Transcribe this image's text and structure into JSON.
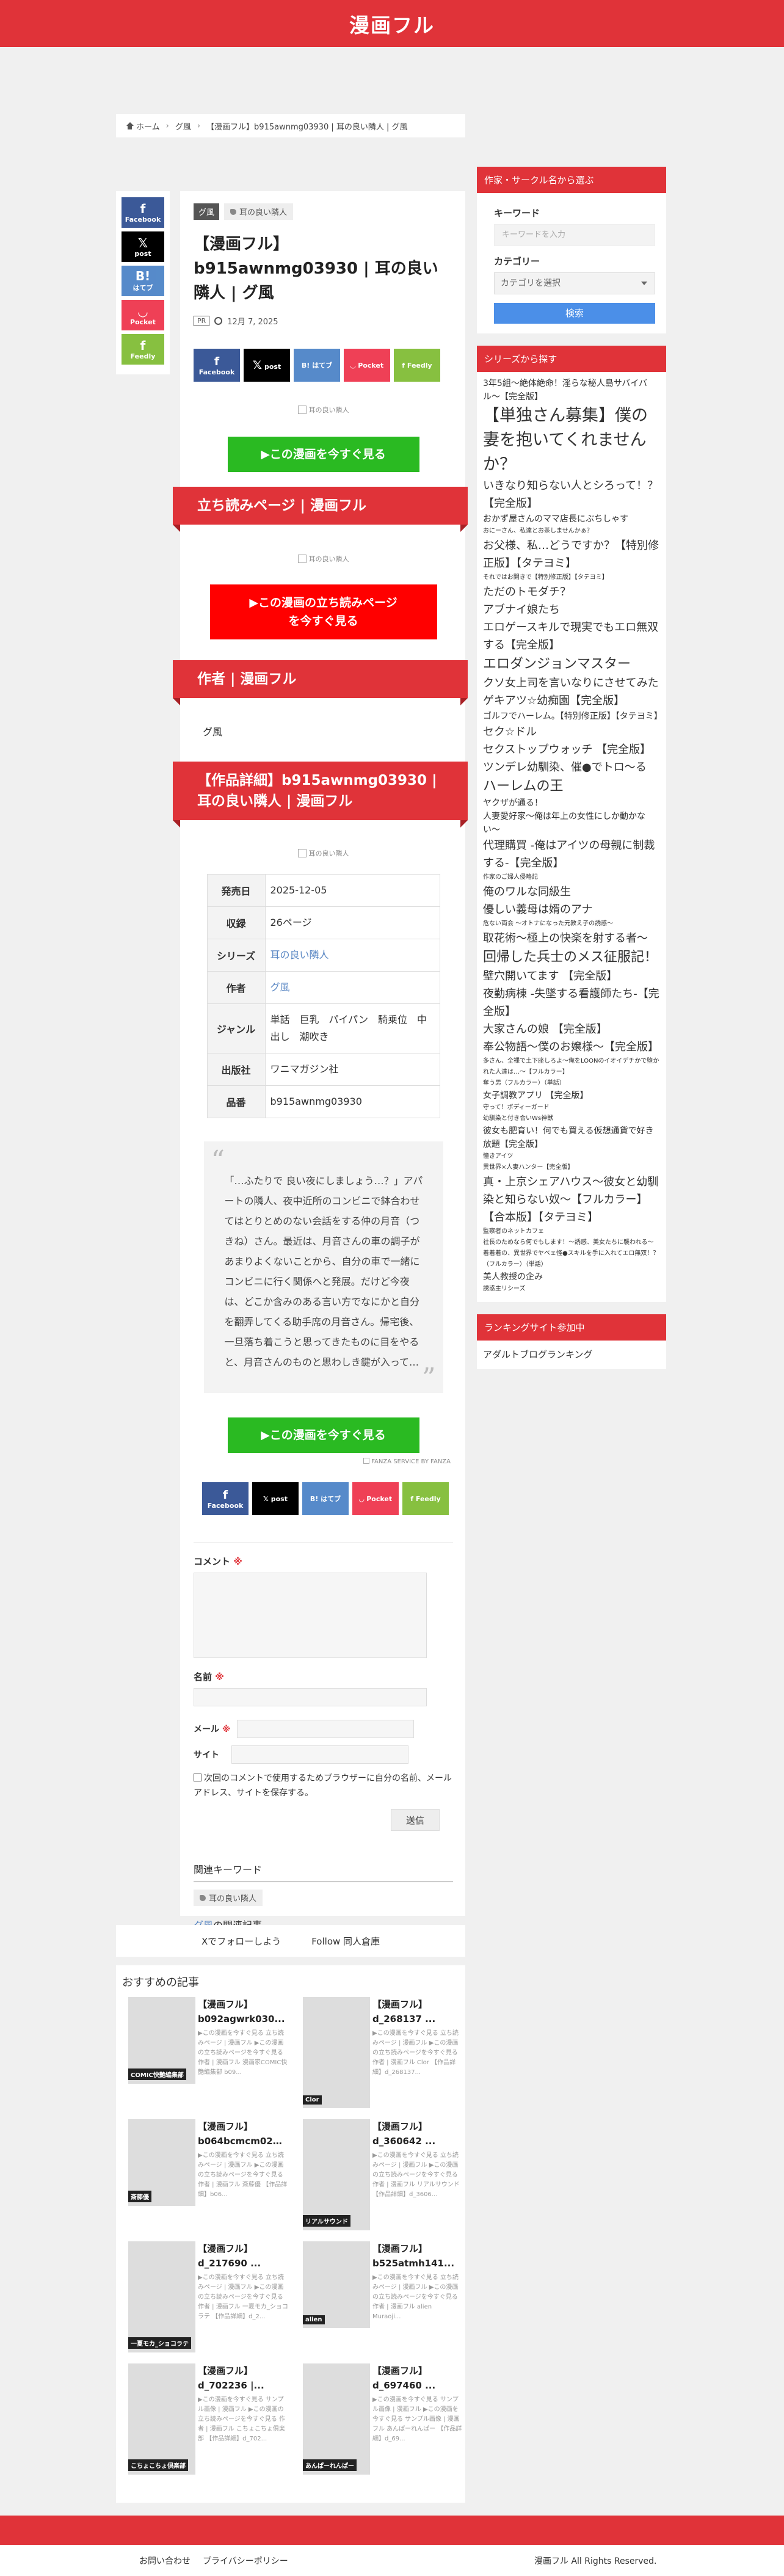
{
  "site": {
    "title": "漫画フル"
  },
  "breadcrumb": {
    "home": "ホーム",
    "category": "グ風",
    "current": "【漫画フル】b915awnmg03930 | 耳の良い隣人 | グ風"
  },
  "share": {
    "facebook": "Facebook",
    "x": "post",
    "hatena": "はてブ",
    "pocket": "Pocket",
    "feedly": "Feedly",
    "x_symbol": "𝕏",
    "hatena_symbol": "B!",
    "feedly_symbol": "f"
  },
  "article": {
    "category": "グ風",
    "tag": "耳の良い隣人",
    "title": "【漫画フル】b915awnmg03930 | 耳の良い隣人 | グ風",
    "pr": "PR",
    "date": "12月 7, 2025",
    "image_alt": "耳の良い隣人",
    "cta_read": "▶この漫画を今すぐ見る",
    "preview_heading": "立ち読みページ | 漫画フル",
    "cta_preview_line1": "▶この漫画の立ち読みページ",
    "cta_preview_line2": "を今すぐ見る",
    "author_heading": "作者 | 漫画フル",
    "author_name": "グ風",
    "detail_heading": "【作品詳細】b915awnmg03930 | 耳の良い隣人 | 漫画フル",
    "details": [
      {
        "label": "発売日",
        "value": "2025-12-05"
      },
      {
        "label": "収録",
        "value": "26ページ"
      },
      {
        "label": "シリーズ",
        "value": "耳の良い隣人"
      },
      {
        "label": "作者",
        "value": "グ風"
      },
      {
        "label": "ジャンル",
        "value": "単話　巨乳　パイパン　騎乗位　中出し　潮吹き"
      },
      {
        "label": "出版社",
        "value": "ワニマガジン社"
      },
      {
        "label": "品番",
        "value": "b915awnmg03930"
      }
    ],
    "quote": "「…ふたりで 良い夜にしましょう…？」アパートの隣人、夜中近所のコンビニで鉢合わせてはとりとめのない会話をする仲の月音（つきね）さん。最近は、月音さんの車の調子があまりよくないことから、自分の車で一緒にコンビニに行く関係へと発展。だけど今夜は、どこか含みのある言い方でなにかと自分を翻弄してくる助手席の月音さん。帰宅後、一旦落ち着こうと思ってきたものに目をやると、月音さんのものと思わしき鍵が入って…",
    "affiliate": "FANZA SERVICE BY FANZA"
  },
  "comment": {
    "label": "コメント",
    "req": "※",
    "name_label": "名前",
    "email_label": "メール",
    "site_label": "サイト",
    "save_info": "次回のコメントで使用するためブラウザーに自分の名前、メールアドレス、サイトを保存する。",
    "submit": "送信"
  },
  "related": {
    "keywords_heading": "関連キーワード",
    "keyword": "耳の良い隣人",
    "comics_author": "グ風",
    "comics_suffix": "の関連記事"
  },
  "follow": {
    "x": "Xでフォローしよう",
    "doujin": "Follow 同人倉庫"
  },
  "recommended": {
    "title": "おすすめの記事",
    "items": [
      {
        "t1": "【漫画フル】",
        "t2": "b092agwrk030...",
        "snippet": "▶この漫画を今すぐ見る 立ち読みページ | 漫画フル ▶この漫画の立ち読みページを今すぐ見る 作者 | 漫画フル 漫画家COMIC快艶編集部 b09...",
        "label": "COMIC快艶編集部"
      },
      {
        "t1": "【漫画フル】",
        "t2": "d_268137 ...",
        "snippet": "▶この漫画を今すぐ見る 立ち読みページ | 漫画フル ▶この漫画の立ち読みページを今すぐ見る 作者 | 漫画フル Clor 【作品詳細】d_268137...",
        "label": "Clor"
      },
      {
        "t1": "【漫画フル】",
        "t2": "b064bcmcm026...",
        "snippet": "▶この漫画を今すぐ見る 立ち読みページ | 漫画フル ▶この漫画の立ち読みページを今すぐ見る 作者 | 漫画フル 斎藤優 【作品詳細】b06...",
        "label": "斎藤優"
      },
      {
        "t1": "【漫画フル】",
        "t2": "d_360642 ...",
        "snippet": "▶この漫画を今すぐ見る 立ち読みページ | 漫画フル ▶この漫画の立ち読みページを今すぐ見る 作者 | 漫画フル リアルサウンド 【作品詳細】d_3606...",
        "label": "リアルサウンド"
      },
      {
        "t1": "【漫画フル】",
        "t2": "d_217690 ...",
        "snippet": "▶この漫画を今すぐ見る 立ち読みページ | 漫画フル ▶この漫画の立ち読みページを今すぐ見る 作者 | 漫画フル 一夏モカ_ショコラテ 【作品詳細】d_2...",
        "label": "一夏モカ_ショコラテ"
      },
      {
        "t1": "【漫画フル】",
        "t2": "b525atmh141...",
        "snippet": "▶この漫画を今すぐ見る 立ち読みページ | 漫画フル ▶この漫画の立ち読みページを今すぐ見る作者 | 漫画フル alien　Muraoji...",
        "label": "alien"
      },
      {
        "t1": "【漫画フル】",
        "t2": "d_702236 |...",
        "snippet": "▶この漫画を今すぐ見る サンプル画像 | 漫画フル ▶この漫画の立ち読みページを今すぐ見る 作者 | 漫画フル こちょこちょ倶楽部 【作品詳細】d_702...",
        "label": "こちょこちょ倶楽部"
      },
      {
        "t1": "【漫画フル】",
        "t2": "d_697460 ...",
        "snippet": "▶この漫画を今すぐ見る サンプル画像 | 漫画フル ▶この漫画を今すぐ見る サンプル画像 | 漫画フル あんぱーれんぱー 【作品詳細】d_69...",
        "label": "あんぱーれんぱー"
      }
    ]
  },
  "sidebar": {
    "search": {
      "heading": "作家・サークル名から選ぶ",
      "keyword_label": "キーワード",
      "keyword_placeholder": "キーワードを入力",
      "category_label": "カテゴリー",
      "category_select": "カテゴリを選択",
      "submit": "検索"
    },
    "series": {
      "heading": "シリーズから探す",
      "tags": [
        {
          "t": "3年5組〜絶体絶命！淫らな秘人島サバイバル〜【完全版】",
          "s": 2
        },
        {
          "t": "【単独さん募集】僕の妻を抱いてくれませんか？",
          "s": 5
        },
        {
          "t": "いきなり知らない人とシろって！？【完全版】",
          "s": 3
        },
        {
          "t": "おかず屋さんのママ店長にぶちしゃす",
          "s": 2
        },
        {
          "t": "おにーさん、私達とお茶しませんかぁ？",
          "s": 1
        },
        {
          "t": "お父様、私…どうですか？【特別修正版】【タテヨミ】",
          "s": 3
        },
        {
          "t": "それではお開きで【特別修正版】【タテヨミ】",
          "s": 1
        },
        {
          "t": "ただのトモダチ？",
          "s": 3
        },
        {
          "t": "アブナイ娘たち",
          "s": 3
        },
        {
          "t": "エロゲースキルで現実でもエロ無双する【完全版】",
          "s": 3
        },
        {
          "t": "エロダンジョンマスター",
          "s": 4
        },
        {
          "t": "クソ女上司を言いなりにさせてみた",
          "s": 3
        },
        {
          "t": "ゲキアツ☆幼痴園【完全版】",
          "s": 3
        },
        {
          "t": "ゴルフでハーレム。【特別修正版】【タテヨミ】",
          "s": 2
        },
        {
          "t": "セク☆ドル",
          "s": 3
        },
        {
          "t": "セクストップウォッチ 【完全版】",
          "s": 3
        },
        {
          "t": "ツンデレ幼馴染、催●でトロ〜る",
          "s": 3
        },
        {
          "t": "ハーレムの王",
          "s": 4
        },
        {
          "t": "ヤクザが通る！",
          "s": 2
        },
        {
          "t": "人妻愛好家〜俺は年上の女性にしか動かない〜",
          "s": 2
        },
        {
          "t": "代理購買 -俺はアイツの母親に制裁する-【完全版】",
          "s": 3
        },
        {
          "t": "作家のご婦人侵略記",
          "s": 1
        },
        {
          "t": "俺のワルな同級生",
          "s": 3
        },
        {
          "t": "優しい義母は婿のアナ",
          "s": 3
        },
        {
          "t": "危ない両会 〜オトナになった元教え子の誘惑〜",
          "s": 1
        },
        {
          "t": "取花術〜極上の快楽を射する者〜",
          "s": 3
        },
        {
          "t": "回帰した兵士のメス征服記！",
          "s": 4
        },
        {
          "t": "壁穴開いてます 【完全版】",
          "s": 3
        },
        {
          "t": "夜勤病棟 -失墜する看護師たち-【完全版】",
          "s": 3
        },
        {
          "t": "大家さんの娘 【完全版】",
          "s": 3
        },
        {
          "t": "奉公物語〜僕のお嬢様〜【完全版】",
          "s": 3
        },
        {
          "t": "多さん、全裸で土下座しろよ〜俺をLOONのイオイデチかで堕かれた人達は…〜【フルカラー】",
          "s": 1
        },
        {
          "t": "奪う男（フルカラー）（単話）",
          "s": 1
        },
        {
          "t": "女子調教アプリ 【完全版】",
          "s": 2
        },
        {
          "t": "守って！ボディーガード",
          "s": 1
        },
        {
          "t": "幼馴染と付き合いWs神獣",
          "s": 1
        },
        {
          "t": "彼女も肥育い！何でも買える仮想通貨で好き放題【完全版】",
          "s": 2
        },
        {
          "t": "憧きアイツ",
          "s": 1
        },
        {
          "t": "異世界×人妻ハンター【完全版】",
          "s": 1
        },
        {
          "t": "真・上京シェアハウス〜彼女と幼馴染と知らない奴〜【フルカラー】【合本版】【タテヨミ】",
          "s": 3
        },
        {
          "t": "監察者のネットカフェ",
          "s": 1
        },
        {
          "t": "社長のためなら何でもします！〜誘惑、美女たちに襲われる〜",
          "s": 1
        },
        {
          "t": "着着着の、異世界でヤベェ怪●スキルを手に入れてエロ無双！？（フルカラー）（単話）",
          "s": 1
        },
        {
          "t": "美人教授の企み",
          "s": 2
        },
        {
          "t": "誘惑主リシーズ",
          "s": 1
        }
      ]
    },
    "ranking": {
      "heading": "ランキングサイト参加中",
      "item": "アダルトブログランキング"
    }
  },
  "footer": {
    "contact": "お問い合わせ",
    "privacy": "プライバシーポリシー",
    "copyright": "漫画フル All Rights Reserved."
  },
  "colors": {
    "brand_red": "#e03339",
    "cta_green": "#2aba22",
    "cta_red": "#ff0000",
    "search_blue": "#4b8fe8"
  }
}
